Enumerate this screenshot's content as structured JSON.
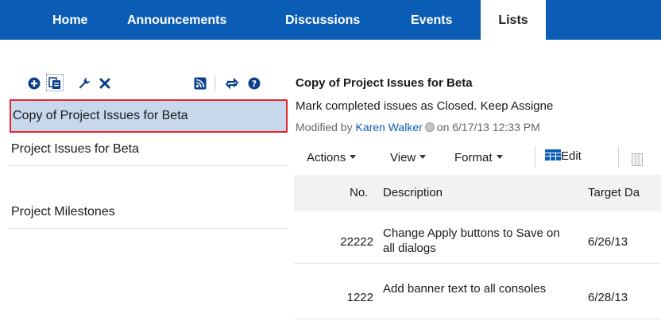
{
  "nav": {
    "tabs": [
      {
        "label": "Home",
        "active": false
      },
      {
        "label": "Announcements",
        "active": false
      },
      {
        "label": "Discussions",
        "active": false
      },
      {
        "label": "Events",
        "active": false
      },
      {
        "label": "Lists",
        "active": true
      }
    ],
    "bar_color": "#0b5cb5"
  },
  "toolbar": {
    "icons": [
      "add-icon",
      "copy-list-icon",
      "wrench-icon",
      "delete-icon",
      "rss-icon",
      "refresh-icon",
      "help-icon"
    ]
  },
  "sidebar": {
    "items": [
      {
        "label": "Copy of Project Issues for Beta",
        "selected": true
      },
      {
        "label": "Project Issues for Beta",
        "selected": false
      },
      {
        "label": "Project Milestones",
        "selected": false
      }
    ]
  },
  "list": {
    "title": "Copy of Project Issues for Beta",
    "description": "Mark completed issues as Closed. Keep Assigne",
    "modified_prefix": "Modified by",
    "author": "Karen Walker",
    "modified_suffix": "on 6/17/13 12:33 PM",
    "menus": {
      "actions": "Actions",
      "view": "View",
      "format": "Format",
      "edit": "Edit"
    },
    "columns": [
      "No.",
      "Description",
      "Target Da"
    ],
    "rows": [
      {
        "no": "22222",
        "description": "Change Apply buttons to Save on all dialogs",
        "target_date": "6/26/13"
      },
      {
        "no": "1222",
        "description": "Add banner text to all consoles",
        "target_date": "6/28/13"
      }
    ]
  }
}
